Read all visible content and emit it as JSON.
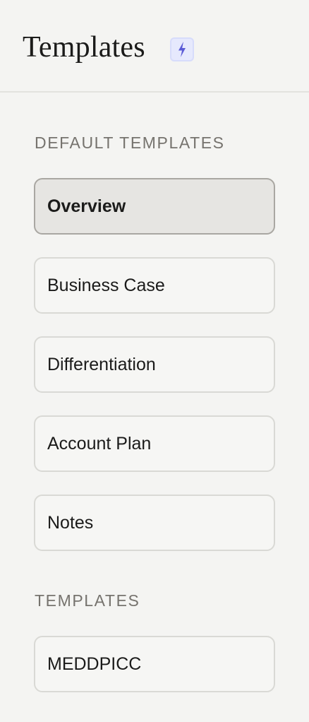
{
  "header": {
    "title": "Templates",
    "badge_icon": "lightning-bolt-icon",
    "badge_color": "#5b5bd6"
  },
  "default_templates": {
    "label": "DEFAULT TEMPLATES",
    "items": [
      {
        "label": "Overview",
        "selected": true
      },
      {
        "label": "Business Case",
        "selected": false
      },
      {
        "label": "Differentiation",
        "selected": false
      },
      {
        "label": "Account Plan",
        "selected": false
      },
      {
        "label": "Notes",
        "selected": false
      }
    ]
  },
  "templates": {
    "label": "TEMPLATES",
    "items": [
      {
        "label": "MEDDPICC",
        "selected": false
      }
    ]
  }
}
